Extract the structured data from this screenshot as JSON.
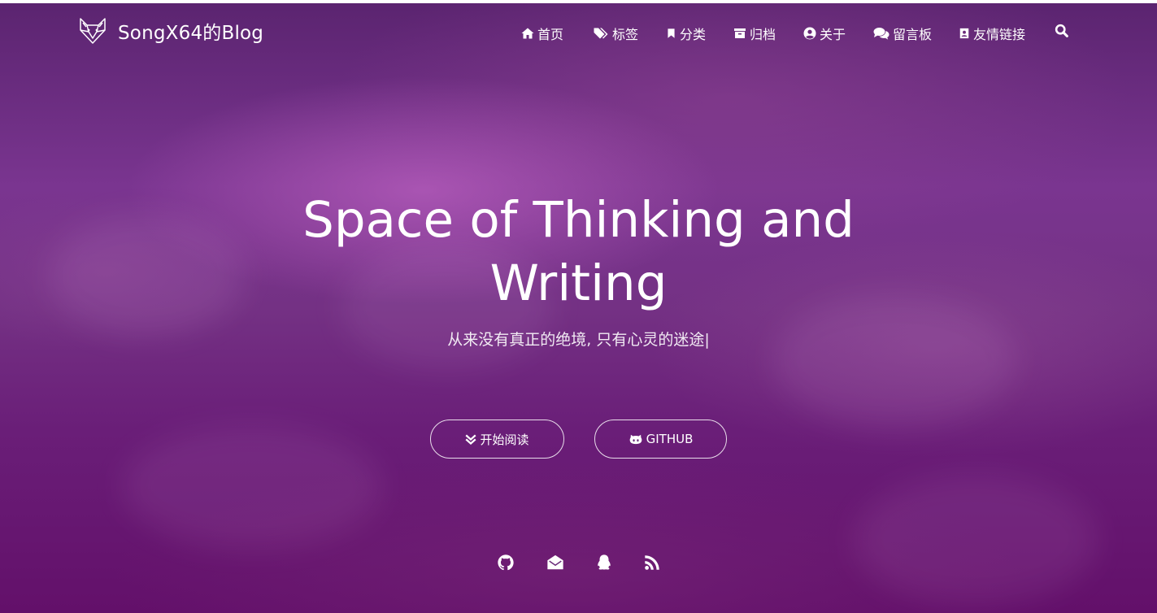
{
  "brand": {
    "name": "SongX64的Blog",
    "logo_icon": "fox-icon"
  },
  "nav": [
    {
      "label": "首页",
      "icon": "home-icon"
    },
    {
      "label": "标签",
      "icon": "tags-icon"
    },
    {
      "label": "分类",
      "icon": "bookmark-icon"
    },
    {
      "label": "归档",
      "icon": "archive-icon"
    },
    {
      "label": "关于",
      "icon": "user-circle-icon"
    },
    {
      "label": "留言板",
      "icon": "comments-icon"
    },
    {
      "label": "友情链接",
      "icon": "address-book-icon"
    }
  ],
  "hero": {
    "title_line1": "Space of Thinking and",
    "title_line2": "Writing",
    "subtitle": "从来没有真正的绝境, 只有心灵的迷途",
    "cursor": "|"
  },
  "buttons": {
    "read": {
      "label": "开始阅读",
      "icon": "angle-double-down-icon"
    },
    "github": {
      "label": "GITHUB",
      "icon": "github-alt-icon"
    }
  },
  "social": [
    "github-icon",
    "envelope-open-icon",
    "qq-icon",
    "rss-icon"
  ],
  "colors": {
    "accent": "#6a1e78",
    "text": "#ffffff"
  }
}
